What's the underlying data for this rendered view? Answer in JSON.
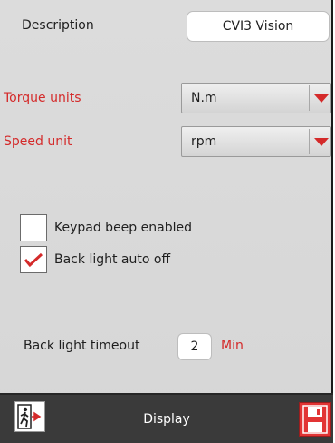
{
  "settings": {
    "description_label": "Description",
    "description_value": "CVI3 Vision",
    "torque_units_label": "Torque units",
    "torque_units_value": "N.m",
    "speed_unit_label": "Speed unit",
    "speed_unit_value": "rpm",
    "keypad_beep_label": "Keypad beep enabled",
    "keypad_beep_checked": false,
    "back_light_auto_off_label": "Back light auto off",
    "back_light_auto_off_checked": true,
    "back_light_timeout_label": "Back light timeout",
    "back_light_timeout_value": "2",
    "back_light_timeout_unit": "Min"
  },
  "bottombar": {
    "title": "Display",
    "exit_icon": "exit-icon",
    "save_icon": "save-icon"
  },
  "colors": {
    "accent_red": "#d42a2a",
    "background": "#d9d9d9",
    "bottombar": "#3a3a3a"
  }
}
